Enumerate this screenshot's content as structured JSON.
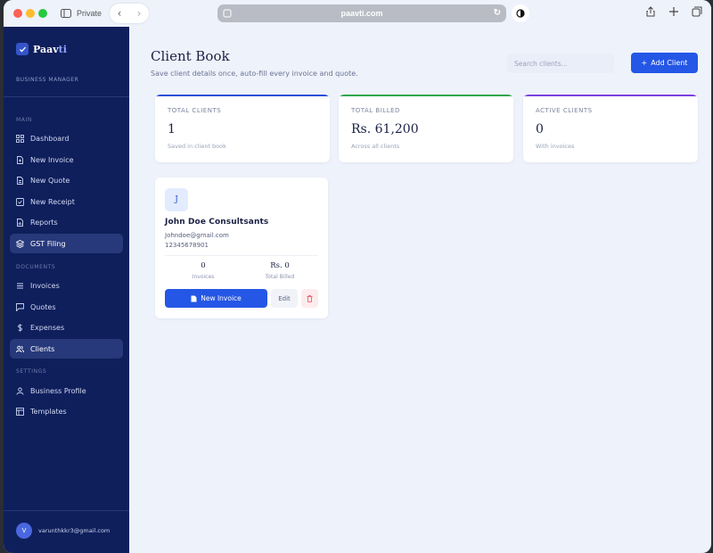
{
  "browser": {
    "private_label": "Private",
    "url": "paavti.com"
  },
  "sidebar": {
    "brand_prefix": "Paav",
    "brand_suffix": "ti",
    "brand_sub": "BUSINESS MANAGER",
    "sections": {
      "main": "MAIN",
      "documents": "DOCUMENTS",
      "settings": "SETTINGS"
    },
    "items": [
      {
        "label": "Dashboard",
        "icon": "grid-icon",
        "active": false
      },
      {
        "label": "New Invoice",
        "icon": "file-plus-icon",
        "active": false
      },
      {
        "label": "New Quote",
        "icon": "file-text-icon",
        "active": false
      },
      {
        "label": "New Receipt",
        "icon": "check-square-icon",
        "active": false
      },
      {
        "label": "Reports",
        "icon": "file-chart-icon",
        "active": false
      },
      {
        "label": "GST Filing",
        "icon": "layers-icon",
        "active": true
      },
      {
        "label": "Invoices",
        "icon": "list-icon",
        "active": false
      },
      {
        "label": "Quotes",
        "icon": "message-square-icon",
        "active": false
      },
      {
        "label": "Expenses",
        "icon": "dollar-icon",
        "active": false
      },
      {
        "label": "Clients",
        "icon": "users-icon",
        "active": true
      },
      {
        "label": "Business Profile",
        "icon": "user-icon",
        "active": false
      },
      {
        "label": "Templates",
        "icon": "layout-icon",
        "active": false
      }
    ],
    "user": {
      "initial": "V",
      "email": "varunthkkr3@gmail.com"
    }
  },
  "header": {
    "title": "Client Book",
    "subtitle": "Save client details once, auto-fill every invoice and quote.",
    "search_placeholder": "Search clients...",
    "add_label": "Add Client"
  },
  "stats": [
    {
      "label": "TOTAL CLIENTS",
      "value": "1",
      "note": "Saved in client book",
      "color": "#2b4fd8"
    },
    {
      "label": "TOTAL BILLED",
      "value": "Rs. 61,200",
      "note": "Across all clients",
      "color": "#2fa64a"
    },
    {
      "label": "ACTIVE CLIENTS",
      "value": "0",
      "note": "With invoices",
      "color": "#7b3fe0"
    }
  ],
  "client": {
    "initial": "J",
    "name": "John Doe Consultsants",
    "email": "Johndoe@gmail.com",
    "phone": "12345678901",
    "invoices_value": "0",
    "invoices_label": "Invoices",
    "billed_value": "Rs. 0",
    "billed_label": "Total Billed",
    "new_invoice_label": "New Invoice",
    "edit_label": "Edit"
  },
  "colors": {
    "sidebar_bg": "#0f1f5c",
    "accent": "#2557e6",
    "page_bg": "#eef2fb"
  }
}
